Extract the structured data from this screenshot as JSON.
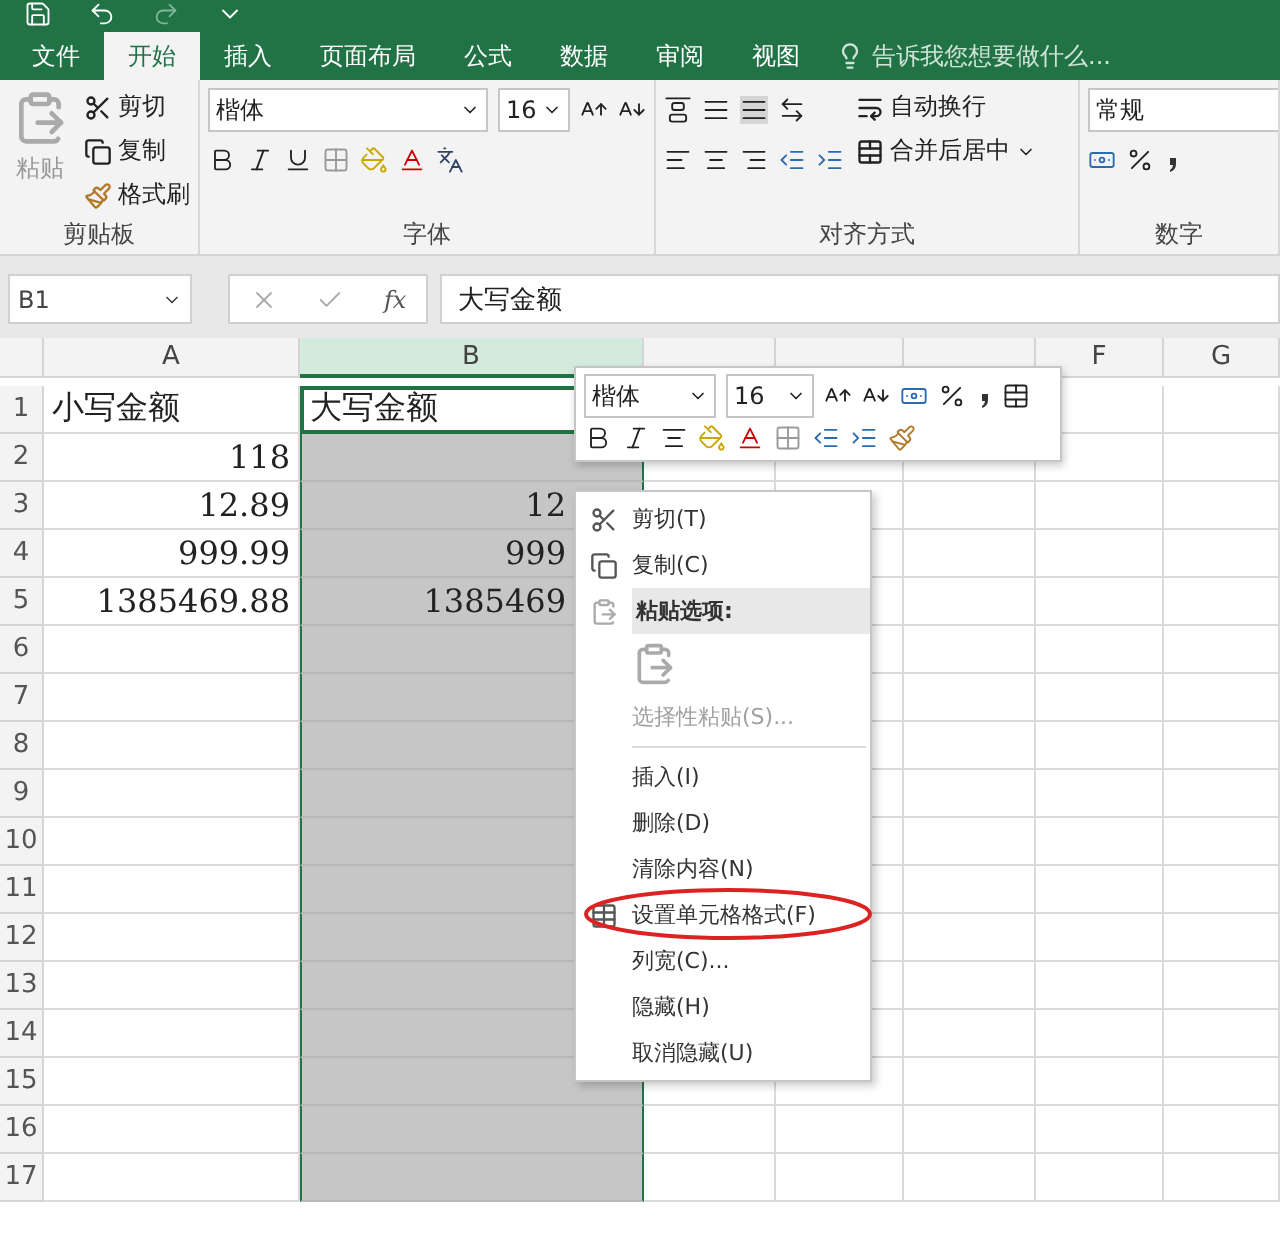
{
  "ribbon_tabs": [
    {
      "label": "文件",
      "selected": false
    },
    {
      "label": "开始",
      "selected": true
    },
    {
      "label": "插入",
      "selected": false
    },
    {
      "label": "页面布局",
      "selected": false
    },
    {
      "label": "公式",
      "selected": false
    },
    {
      "label": "数据",
      "selected": false
    },
    {
      "label": "审阅",
      "selected": false
    },
    {
      "label": "视图",
      "selected": false
    }
  ],
  "tell_me": {
    "placeholder": "告诉我您想要做什么..."
  },
  "ribbon": {
    "clipboard": {
      "title": "剪贴板",
      "paste": "粘贴",
      "cut": "剪切",
      "copy": "复制",
      "format_painter": "格式刷"
    },
    "font": {
      "title": "字体",
      "font_name": "楷体",
      "font_size": "16"
    },
    "alignment": {
      "title": "对齐方式",
      "wrap_text": "自动换行",
      "merge_center": "合并后居中"
    },
    "number": {
      "title": "数字",
      "format": "常规"
    }
  },
  "formula_bar": {
    "name_box": "B1",
    "function_label": "fx",
    "formula": "大写金额"
  },
  "sheet": {
    "columns": [
      {
        "label": "A",
        "selected": false
      },
      {
        "label": "B",
        "selected": true
      },
      {
        "selected": false
      },
      {
        "selected": false
      },
      {
        "selected": false
      },
      {
        "label": "F",
        "selected": false
      },
      {
        "label": "G",
        "selected": false
      }
    ],
    "rows": [
      {
        "number": "1",
        "a": "小写金额",
        "b": "大写金额",
        "active": true
      },
      {
        "number": "2",
        "a": "118",
        "active": false
      },
      {
        "number": "3",
        "a": "12.89",
        "b": "12",
        "active": false
      },
      {
        "number": "4",
        "a": "999.99",
        "b": "999",
        "active": false
      },
      {
        "number": "5",
        "a": "1385469.88",
        "b": "1385469",
        "active": false
      },
      {
        "number": "6",
        "active": false
      },
      {
        "number": "7",
        "active": false
      },
      {
        "number": "8",
        "active": false
      },
      {
        "number": "9",
        "active": false
      },
      {
        "number": "10",
        "active": false
      },
      {
        "number": "11",
        "active": false
      },
      {
        "number": "12",
        "active": false
      },
      {
        "number": "13",
        "active": false
      },
      {
        "number": "14",
        "active": false
      },
      {
        "number": "15",
        "active": false
      },
      {
        "number": "16",
        "active": false
      },
      {
        "number": "17",
        "active": false
      }
    ]
  },
  "mini_toolbar": {
    "font_name": "楷体",
    "font_size": "16"
  },
  "context_menu": {
    "items": [
      {
        "kind": "command",
        "label": "剪切(T)",
        "disabled": false,
        "circled": false
      },
      {
        "kind": "command",
        "label": "复制(C)",
        "disabled": false,
        "circled": false
      },
      {
        "kind": "header",
        "label": "粘贴选项:"
      },
      {
        "kind": "paste_options"
      },
      {
        "kind": "command",
        "label": "选择性粘贴(S)...",
        "disabled": true,
        "circled": false
      },
      {
        "kind": "separator"
      },
      {
        "kind": "command",
        "label": "插入(I)",
        "disabled": false,
        "circled": false
      },
      {
        "kind": "command",
        "label": "删除(D)",
        "disabled": false,
        "circled": false
      },
      {
        "kind": "command",
        "label": "清除内容(N)",
        "disabled": false,
        "circled": false
      },
      {
        "kind": "command",
        "label": "设置单元格格式(F)",
        "disabled": false,
        "circled": true
      },
      {
        "kind": "command",
        "label": "列宽(C)...",
        "disabled": false,
        "circled": false
      },
      {
        "kind": "command",
        "label": "隐藏(H)",
        "disabled": false,
        "circled": false
      },
      {
        "kind": "command",
        "label": "取消隐藏(U)",
        "disabled": false,
        "circled": false
      }
    ]
  }
}
